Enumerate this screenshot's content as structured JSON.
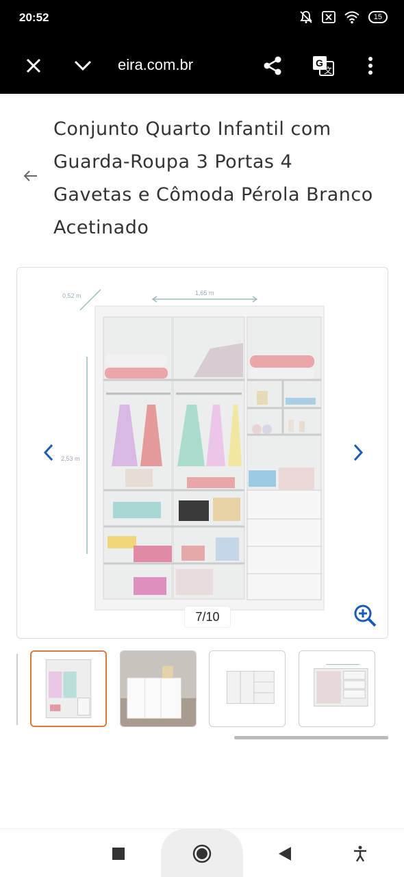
{
  "status_bar": {
    "time": "20:52",
    "battery": "15",
    "icons": [
      "mute-icon",
      "close-box-icon",
      "wifi-icon",
      "battery-icon"
    ]
  },
  "toolbar": {
    "url": "eira.com.br",
    "close_icon": "close-icon",
    "collapse_icon": "chevron-down-icon",
    "share_icon": "share-icon",
    "translate_icon": "translate-icon",
    "menu_icon": "more-vert-icon"
  },
  "product": {
    "title": "Conjunto Quarto Infantil com Guarda-Roupa 3 Portas 4 Gavetas e Cômoda Pérola Branco Acetinado"
  },
  "gallery": {
    "counter": "7/10",
    "dimension_depth": "0,52 m",
    "dimension_width": "1,65 m",
    "dimension_height": "2,53 m",
    "accent": "#1a5bb8"
  },
  "thumbnails": [
    {
      "label": "thumbnail-1",
      "active": true
    },
    {
      "label": "thumbnail-2",
      "active": false
    },
    {
      "label": "thumbnail-3",
      "active": false
    },
    {
      "label": "thumbnail-4",
      "active": false
    }
  ],
  "nav_bar": {
    "icons": [
      "recents-icon",
      "home-icon",
      "back-icon",
      "accessibility-icon"
    ]
  }
}
